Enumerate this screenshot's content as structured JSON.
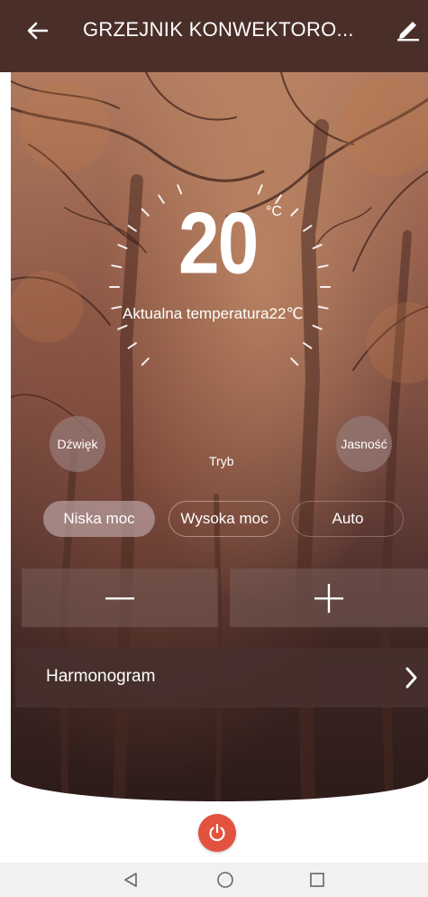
{
  "header": {
    "title": "GRZEJNIK KONWEKTORO...",
    "back_icon": "arrow-left-icon",
    "edit_icon": "pencil-icon"
  },
  "thermostat": {
    "set_temperature": "20",
    "unit": "°C",
    "current_label": "Aktualna temperatura22℃"
  },
  "controls": {
    "sound_label": "Dźwięk",
    "brightness_label": "Jasność",
    "mode_label": "Tryb"
  },
  "modes": {
    "low": "Niska moc",
    "high": "Wysoka moc",
    "auto": "Auto",
    "selected": "Niska moc"
  },
  "stepper": {
    "minus_icon": "minus-icon",
    "plus_icon": "plus-icon"
  },
  "schedule": {
    "label": "Harmonogram",
    "chevron_icon": "chevron-right-icon"
  },
  "power": {
    "icon": "power-icon",
    "color": "#e2523e"
  },
  "colors": {
    "header_bg": "#4a2f28",
    "accent": "#e2523e"
  }
}
